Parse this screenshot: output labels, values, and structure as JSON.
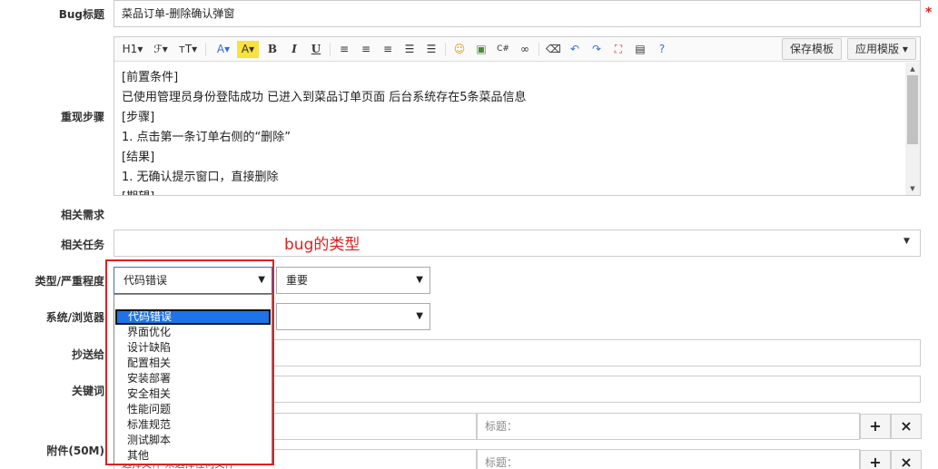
{
  "form": {
    "bug_title": {
      "label": "Bug标题",
      "value": "菜品订单-删除确认弹窗",
      "required": "*"
    },
    "repro": {
      "label": "重现步骤",
      "toolbar": {
        "heading": "H1▾",
        "font": "ℱ▾",
        "size": "тT▾",
        "font_color": "A▾",
        "bg_color": "A▾",
        "bold": "B",
        "italic": "I",
        "underline": "U",
        "save_template": "保存模板",
        "apply_template": "应用模版 ▾"
      },
      "lines": [
        "[前置条件]",
        "已使用管理员身份登陆成功 已进入到菜品订单页面 后台系统存在5条菜品信息",
        "[步骤]",
        "1. 点击第一条订单右侧的“删除”",
        "[结果]",
        "1. 无确认提示窗口，直接删除",
        "[期望]"
      ]
    },
    "related_req": {
      "label": "相关需求"
    },
    "related_task": {
      "label": "相关任务",
      "value": ""
    },
    "type_severity": {
      "label": "类型/严重程度",
      "type_value": "代码错误",
      "severity_value": "重要",
      "type_options": [
        "代码错误",
        "界面优化",
        "设计缺陷",
        "配置相关",
        "安装部署",
        "安全相关",
        "性能问题",
        "标准规范",
        "测试脚本",
        "其他"
      ],
      "selected_index": 0
    },
    "os_browser": {
      "label": "系统/浏览器"
    },
    "cc": {
      "label": "抄送给"
    },
    "keywords": {
      "label": "关键词"
    },
    "attachment": {
      "label": "附件(50M)",
      "title_placeholder": "标题：",
      "add": "+",
      "remove": "×",
      "partial_text": "选择文件 未选择任何文件"
    }
  },
  "annotation": {
    "text": "bug的类型"
  },
  "colors": {
    "annotation": "#e02020",
    "selected_option": "#1e73e8"
  }
}
